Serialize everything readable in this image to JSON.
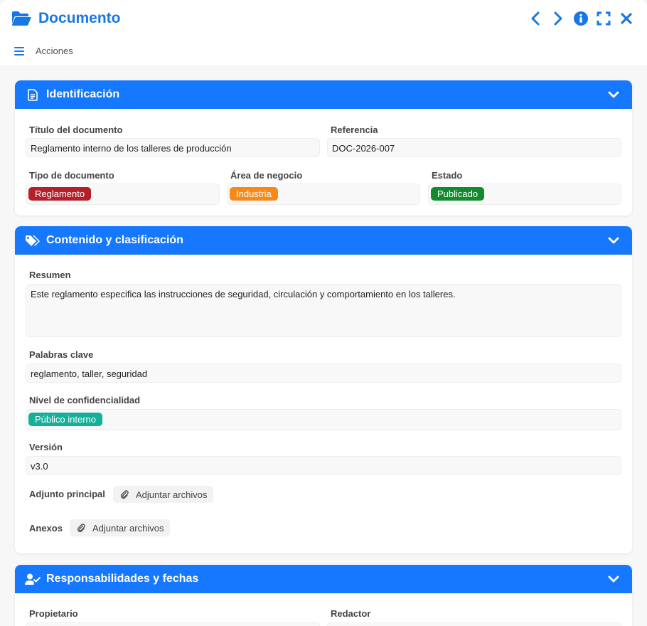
{
  "header": {
    "title": "Documento",
    "menu_label": "Acciones"
  },
  "colors": {
    "accent": "#1677ff",
    "tag_reglamento": "#b3202a",
    "tag_industria": "#f5891a",
    "tag_publicado": "#148a2f",
    "tag_publico_interno": "#14b09a"
  },
  "sections": {
    "identificacion": {
      "title": "Identificación",
      "titulo_label": "Título del documento",
      "titulo_value": "Reglamento interno de los talleres de producción",
      "referencia_label": "Referencia",
      "referencia_value": "DOC-2026-007",
      "tipo_label": "Tipo de documento",
      "tipo_value": "Reglamento",
      "area_label": "Área de negocio",
      "area_value": "Industria",
      "estado_label": "Estado",
      "estado_value": "Publicado"
    },
    "contenido": {
      "title": "Contenido y clasificación",
      "resumen_label": "Resumen",
      "resumen_value": "Este reglamento especifica las instrucciones de seguridad, circulación y comportamiento en los talleres.",
      "palabras_label": "Palabras clave",
      "palabras_value": "reglamento, taller, seguridad",
      "nivel_label": "Nivel de confidencialidad",
      "nivel_value": "Público interno",
      "version_label": "Versión",
      "version_value": "v3.0",
      "adjunto_label": "Adjunto principal",
      "adjunto_button": "Adjuntar archivos",
      "anexos_label": "Anexos",
      "anexos_button": "Adjuntar archivos"
    },
    "responsabilidades": {
      "title": "Responsabilidades y fechas",
      "propietario_label": "Propietario",
      "redactor_label": "Redactor"
    }
  }
}
